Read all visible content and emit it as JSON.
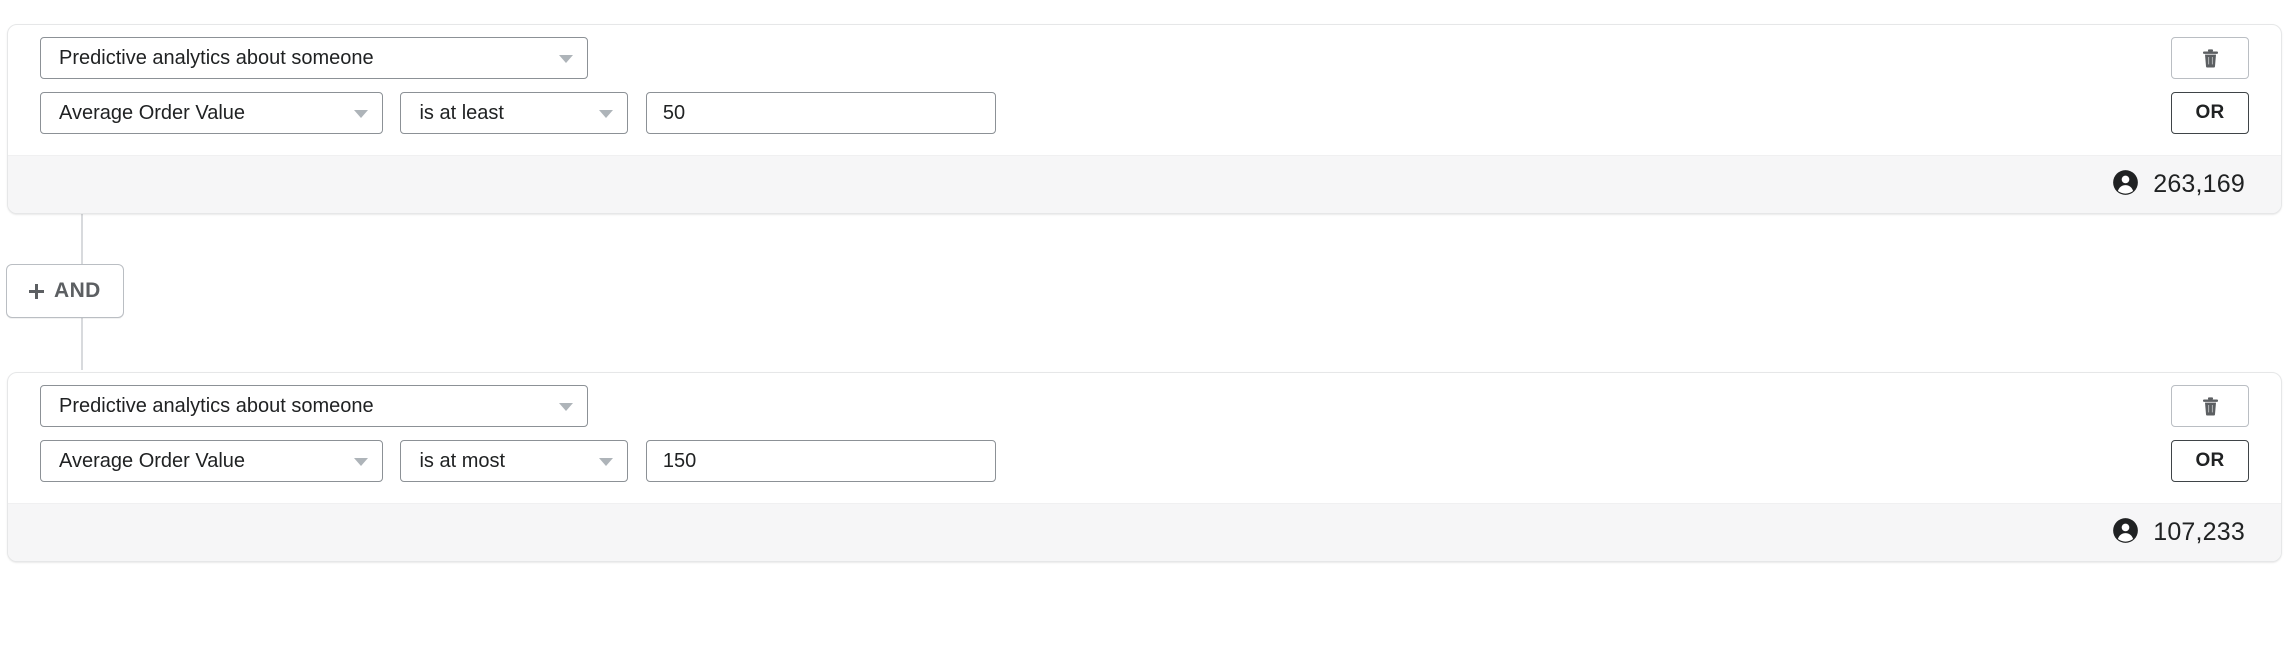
{
  "groups": [
    {
      "subject": {
        "value": "Predictive analytics about someone",
        "icon": "chevron-down-icon"
      },
      "field": {
        "value": "Average Order Value",
        "icon": "chevron-down-icon"
      },
      "operator": {
        "value": "is at least",
        "icon": "chevron-down-icon"
      },
      "amount": {
        "value": "50",
        "placeholder": ""
      },
      "delete_button": {
        "icon": "trash-icon",
        "label": ""
      },
      "or_button": {
        "label": "OR"
      },
      "footer": {
        "icon": "person-icon",
        "count": "263,169"
      }
    },
    {
      "subject": {
        "value": "Predictive analytics about someone",
        "icon": "chevron-down-icon"
      },
      "field": {
        "value": "Average Order Value",
        "icon": "chevron-down-icon"
      },
      "operator": {
        "value": "is at most",
        "icon": "chevron-down-icon"
      },
      "amount": {
        "value": "150",
        "placeholder": ""
      },
      "delete_button": {
        "icon": "trash-icon",
        "label": ""
      },
      "or_button": {
        "label": "OR"
      },
      "footer": {
        "icon": "person-icon",
        "count": "107,233"
      }
    }
  ],
  "and_button": {
    "label": "AND",
    "icon": "plus-icon"
  },
  "colors": {
    "card_border": "#e6e7e8",
    "input_border": "#8c9196",
    "or_border": "#3f4447",
    "delete_border": "#babec3",
    "footer_bg": "#f6f6f7",
    "connector": "#d8dadd",
    "text": "#202223",
    "muted_text": "#5c5f62",
    "caret": "#aeb4b9"
  }
}
